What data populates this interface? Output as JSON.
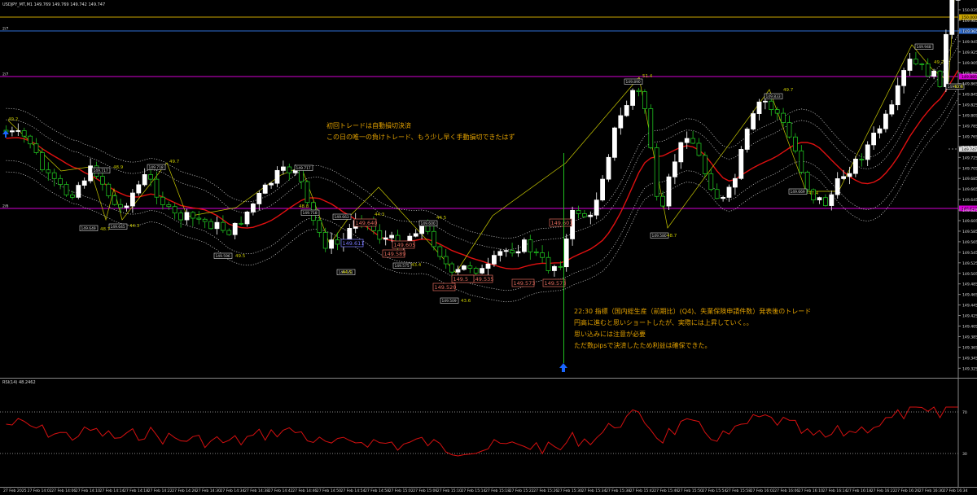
{
  "window": {
    "header": "USDJPY_MT,M1  149.769 149.769 149.742 149.747",
    "indicator_header": "RSI(14) 48.2462"
  },
  "price_axis": {
    "ticks": [
      "150.035",
      "149.985",
      "149.965",
      "149.945",
      "149.925",
      "149.905",
      "149.885",
      "149.865",
      "149.845",
      "149.825",
      "149.805",
      "149.785",
      "149.765",
      "149.745",
      "149.725",
      "149.705",
      "149.685",
      "149.665",
      "149.645",
      "149.625",
      "149.605",
      "149.585",
      "149.565",
      "149.545",
      "149.525",
      "149.505",
      "149.485",
      "149.465",
      "149.445",
      "149.425",
      "149.405",
      "149.385",
      "149.365",
      "149.345",
      "149.325"
    ],
    "current_price": "149.747",
    "levels": [
      {
        "label": "150.000",
        "color": "#c8a400",
        "left_tag": ""
      },
      {
        "label": "149.975",
        "color": "#2f6fd6",
        "left_tag": "2/7"
      },
      {
        "label": "149.885",
        "color": "#d400d4",
        "left_tag": "2/7"
      },
      {
        "label": "149.627",
        "color": "#d400d4",
        "left_tag": "2/6"
      }
    ]
  },
  "rsi_axis": {
    "ticks": [
      "70",
      "30"
    ]
  },
  "time_axis": {
    "labels": [
      "27 Feb 2025",
      "27 Feb 14:02",
      "27 Feb 14:06",
      "27 Feb 14:10",
      "27 Feb 14:14",
      "27 Feb 14:18",
      "27 Feb 14:22",
      "27 Feb 14:26",
      "27 Feb 14:30",
      "27 Feb 14:34",
      "27 Feb 14:38",
      "27 Feb 14:42",
      "27 Feb 14:46",
      "27 Feb 14:50",
      "27 Feb 14:54",
      "27 Feb 14:58",
      "27 Feb 15:02",
      "27 Feb 15:06",
      "27 Feb 15:10",
      "27 Feb 15:14",
      "27 Feb 15:18",
      "27 Feb 15:22",
      "27 Feb 15:26",
      "27 Feb 15:30",
      "27 Feb 15:34",
      "27 Feb 15:38",
      "27 Feb 15:42",
      "27 Feb 15:46",
      "27 Feb 15:50",
      "27 Feb 15:54",
      "27 Feb 15:58",
      "27 Feb 16:02",
      "27 Feb 16:06",
      "27 Feb 16:10",
      "27 Feb 16:14",
      "27 Feb 16:18",
      "27 Feb 16:22",
      "27 Feb 16:26",
      "27 Feb 16:30",
      "27 Feb 16:34"
    ]
  },
  "annotations": {
    "note1": [
      "初回トレードは自動損切決済",
      "この日の唯一の負けトレード、もう少し早く手動損切できたはず"
    ],
    "note2": [
      "22:30 指標（国内総生産（前期比）(Q4)、失業保険申請件数）発表後のトレード",
      "円高に進むと思いショートしたが、実際には上昇していく。。",
      "思い込みには注意が必要",
      "ただ数pipsで決済したため利益は確保できた。"
    ]
  },
  "price_labels": {
    "boxes": [
      "149.717",
      "149.718",
      "149.649",
      "149.645",
      "149.717",
      "149.596",
      "149.718",
      "149.663",
      "149.561",
      "149.575",
      "149.600",
      "149.509",
      "149.890",
      "149.580",
      "149.833",
      "149.669",
      "149.948",
      "149.879"
    ],
    "trades": [
      "149.640",
      "149.611",
      "149.605",
      "149.589",
      "149.520",
      "149.547",
      "149.535",
      "149.573",
      "149.573",
      "149.601",
      "149.5"
    ],
    "fib": [
      "49.2",
      "49.7",
      "48.7",
      "44.3",
      "48.9",
      "49.5",
      "48.8",
      "44.5",
      "44.3",
      "43.4",
      "44.5",
      "43.6",
      "51.4",
      "48.7",
      "49.7",
      "47.4",
      "49.2",
      "40.6"
    ]
  },
  "colors": {
    "bull": "#ffffff",
    "bear": "#1fbf1f",
    "ma": "#e01010",
    "band": "#cfcfcf",
    "zigzag": "#c8c800",
    "annotation": "#e2a100",
    "trade_label": "#e06a5c",
    "trade_label_blue": "#7a7aff",
    "rsi": "#d51010",
    "arrow_blue": "#1a66ff"
  }
}
